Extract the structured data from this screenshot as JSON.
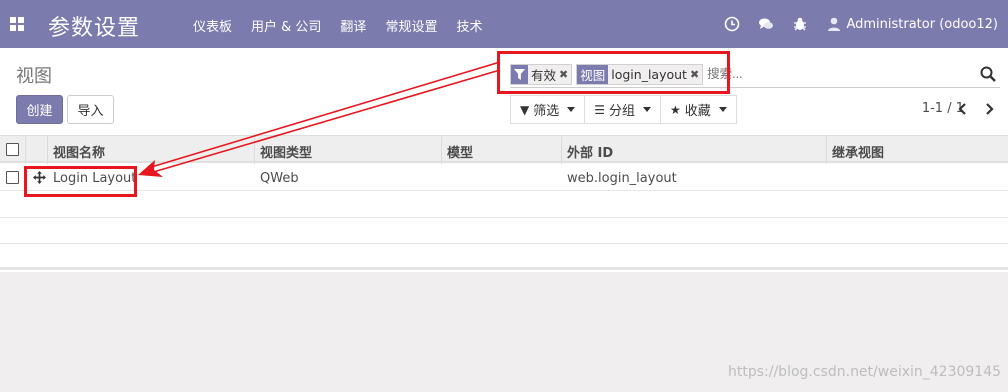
{
  "app": {
    "title": "参数设置",
    "menu": [
      "仪表板",
      "用户 & 公司",
      "翻译",
      "常规设置",
      "技术"
    ],
    "user": "Administrator (odoo12)"
  },
  "control_panel": {
    "breadcrumb": "视图",
    "create_label": "创建",
    "import_label": "导入",
    "search": {
      "facets": [
        {
          "label_icon": "filter-icon",
          "value": "有效"
        },
        {
          "label": "视图",
          "value": "login_layout"
        }
      ],
      "placeholder": "搜索..."
    },
    "filters_label": "筛选",
    "groupby_label": "分组",
    "favorites_label": "收藏",
    "pager": "1-1 / 1"
  },
  "list": {
    "columns": [
      "视图名称",
      "视图类型",
      "模型",
      "外部 ID",
      "继承视图"
    ],
    "rows": [
      {
        "name": "Login Layout",
        "type": "QWeb",
        "model": "",
        "external_id": "web.login_layout",
        "inherit": ""
      }
    ]
  },
  "watermark": "https://blog.csdn.net/weixin_42309145",
  "colors": {
    "brand": "#7c7bad",
    "annotation": "#e8161e"
  },
  "icons": [
    "apps-icon",
    "clock-icon",
    "chat-icon",
    "bug-icon",
    "user-icon",
    "filter-icon",
    "search-icon",
    "bars-icon",
    "star-icon",
    "chevron-left-icon",
    "chevron-right-icon",
    "move-icon"
  ]
}
